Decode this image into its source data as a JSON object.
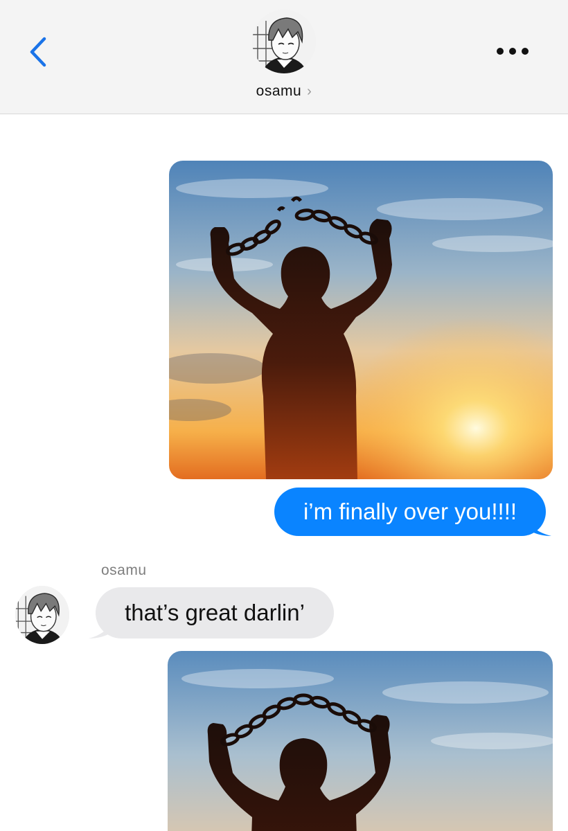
{
  "header": {
    "contact_name": "osamu",
    "chevron": "›",
    "back_icon": "chevron-left-icon",
    "more_icon": "ellipsis-icon",
    "avatar": "manga-style avatar"
  },
  "messages": {
    "sent_text": "i’m finally over you!!!!",
    "received_sender": "osamu",
    "received_text": "that’s great darlin’"
  },
  "colors": {
    "sent_bubble": "#0a84ff",
    "received_bubble": "#e9e9eb",
    "header_bg": "#f4f4f4",
    "accent": "#1a73e8"
  }
}
